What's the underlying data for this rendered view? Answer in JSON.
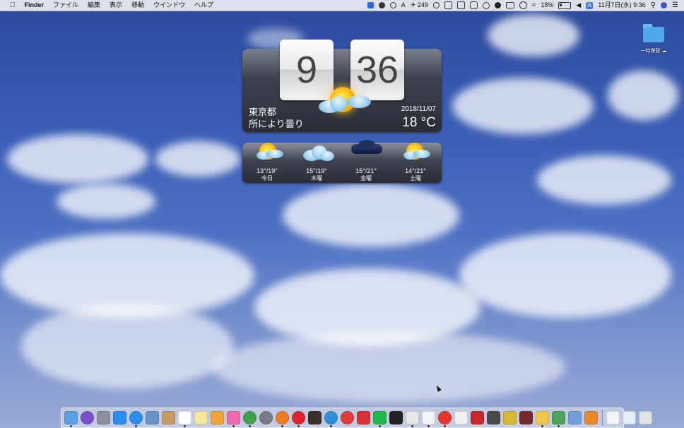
{
  "menubar": {
    "apple_icon": "apple-icon",
    "app_name": "Finder",
    "menus": [
      "ファイル",
      "編集",
      "表示",
      "移動",
      "ウインドウ",
      "ヘルプ"
    ],
    "status": {
      "counter": "249",
      "battery": "18%",
      "ime": "A",
      "datetime": "11月7日(水) 9:36"
    }
  },
  "desktop": {
    "folder_label": "一時保管"
  },
  "clock_widget": {
    "hour": "9",
    "minute": "36",
    "city": "東京都",
    "condition": "所により曇り",
    "date": "2018/11/07",
    "temperature": "18 °C",
    "weather_icon": "partly-cloudy-icon"
  },
  "forecast": [
    {
      "range": "13°/19°",
      "day": "今日",
      "icon": "sun-cloud-icon"
    },
    {
      "range": "15°/19°",
      "day": "木曜",
      "icon": "cloud-icon"
    },
    {
      "range": "15°/21°",
      "day": "金曜",
      "icon": "dark-cloud-icon"
    },
    {
      "range": "14°/21°",
      "day": "土曜",
      "icon": "sun-cloud-icon"
    }
  ],
  "dock": {
    "icons": [
      {
        "name": "finder-icon",
        "color": "#5aa0e6"
      },
      {
        "name": "siri-icon",
        "color": "#7a4fc9"
      },
      {
        "name": "launchpad-icon",
        "color": "#8a8f99"
      },
      {
        "name": "app-store-icon",
        "color": "#2d8cf0"
      },
      {
        "name": "safari-icon",
        "color": "#2f8fe8"
      },
      {
        "name": "preview-icon",
        "color": "#6a93c8"
      },
      {
        "name": "contacts-icon",
        "color": "#c79b62"
      },
      {
        "name": "calendar-icon",
        "color": "#ffffff"
      },
      {
        "name": "notes-icon",
        "color": "#f8e79a"
      },
      {
        "name": "photos-icon",
        "color": "#f2a33c"
      },
      {
        "name": "itunes-icon",
        "color": "#f06ab0"
      },
      {
        "name": "chrome-icon",
        "color": "#3fa14a"
      },
      {
        "name": "system-preferences-icon",
        "color": "#777b84"
      },
      {
        "name": "firefox-icon",
        "color": "#f07a1c"
      },
      {
        "name": "opera-icon",
        "color": "#e0242b"
      },
      {
        "name": "app-icon-dark",
        "color": "#3a2f2a"
      },
      {
        "name": "tweetbot-icon",
        "color": "#2f8fd8"
      },
      {
        "name": "vivaldi-icon",
        "color": "#e23b3b"
      },
      {
        "name": "app-icon-red",
        "color": "#d83030"
      },
      {
        "name": "line-icon",
        "color": "#20b84a"
      },
      {
        "name": "app-icon-black",
        "color": "#222222"
      },
      {
        "name": "mail-icon",
        "color": "#e8e8e8"
      },
      {
        "name": "textedit-icon",
        "color": "#f4f4f4"
      },
      {
        "name": "media-player-icon",
        "color": "#e8342a"
      },
      {
        "name": "document-icon",
        "color": "#f1f1f1"
      },
      {
        "name": "pdf-icon",
        "color": "#c8282c"
      },
      {
        "name": "app-icon-gray",
        "color": "#4a4a4a"
      },
      {
        "name": "app-icon-yellow",
        "color": "#d8b830"
      },
      {
        "name": "app-icon-maroon",
        "color": "#7a2a2a"
      },
      {
        "name": "stickies-icon",
        "color": "#f2c64a"
      },
      {
        "name": "app-icon-green",
        "color": "#4ba55a"
      },
      {
        "name": "app-icon-multicolor",
        "color": "#6fa0d8"
      },
      {
        "name": "app-icon-orange",
        "color": "#e88a2a"
      },
      {
        "name": "folder-stack-icon",
        "color": "#f4f4f4"
      },
      {
        "name": "documents-stack-icon",
        "color": "#e4ecf6"
      },
      {
        "name": "trash-icon",
        "color": "#dfe3e8"
      }
    ]
  }
}
